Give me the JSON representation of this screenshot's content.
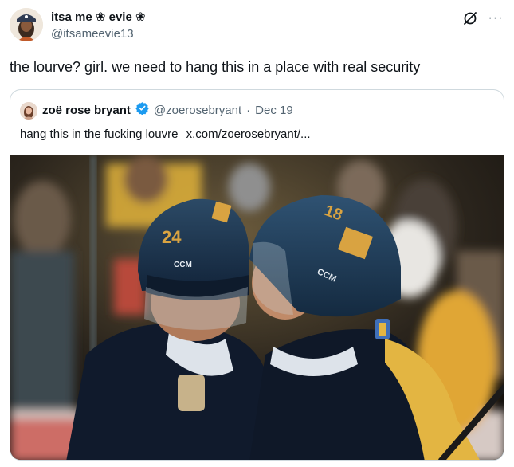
{
  "author": {
    "display_name": "itsa me ❀ evie ❀",
    "handle": "@itsameevie13"
  },
  "tweet": {
    "text": "the lourve? girl. we need to hang this in a place with real security"
  },
  "actions": {
    "more_label": "···"
  },
  "quoted": {
    "display_name": "zoë rose bryant",
    "handle": "@zoerosebryant",
    "separator": "·",
    "date": "Dec 19",
    "text": "hang this in the fucking louvre",
    "link": "x.com/zoerosebryant/..."
  },
  "media": {
    "helmet_left_number": "24",
    "helmet_right_number": "18",
    "helmet_brand": "CCM"
  },
  "colors": {
    "text_primary": "#0f1419",
    "text_secondary": "#536471",
    "border": "#cfd9de",
    "verified": "#1d9bf0",
    "jersey_navy": "#101a2c",
    "helmet_navy": "#1e2f45",
    "gold": "#d9a341"
  }
}
